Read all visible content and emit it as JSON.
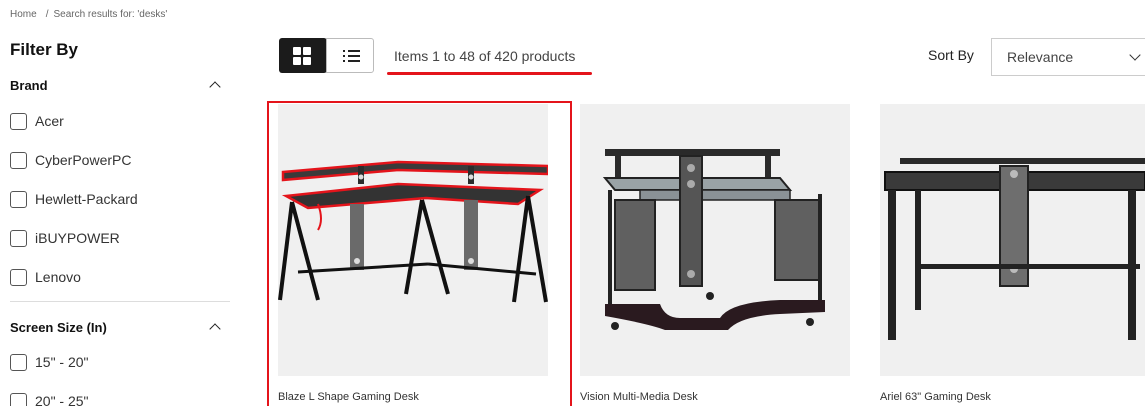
{
  "breadcrumb": {
    "home": "Home",
    "separator": "/",
    "current": "Search results for: 'desks'"
  },
  "filters": {
    "title": "Filter By",
    "brand": {
      "label": "Brand",
      "options": [
        "Acer",
        "CyberPowerPC",
        "Hewlett-Packard",
        "iBUYPOWER",
        "Lenovo"
      ]
    },
    "screen_size": {
      "label": "Screen Size (In)",
      "options": [
        "15\" - 20\"",
        "20\" - 25\""
      ]
    }
  },
  "toolbar": {
    "grid_icon": "grid-view-icon",
    "list_icon": "list-view-icon",
    "item_count": "Items 1 to 48 of 420 products",
    "sort_label": "Sort By",
    "sort_value": "Relevance"
  },
  "colors": {
    "accent": "#e4141b",
    "dark": "#1b1b1b",
    "image_bg": "#f0f0f0"
  },
  "products": [
    {
      "name": "Blaze L Shape Gaming Desk",
      "selected": true
    },
    {
      "name": "Vision Multi-Media Desk",
      "selected": false
    },
    {
      "name": "Ariel 63\" Gaming Desk",
      "selected": false
    }
  ]
}
